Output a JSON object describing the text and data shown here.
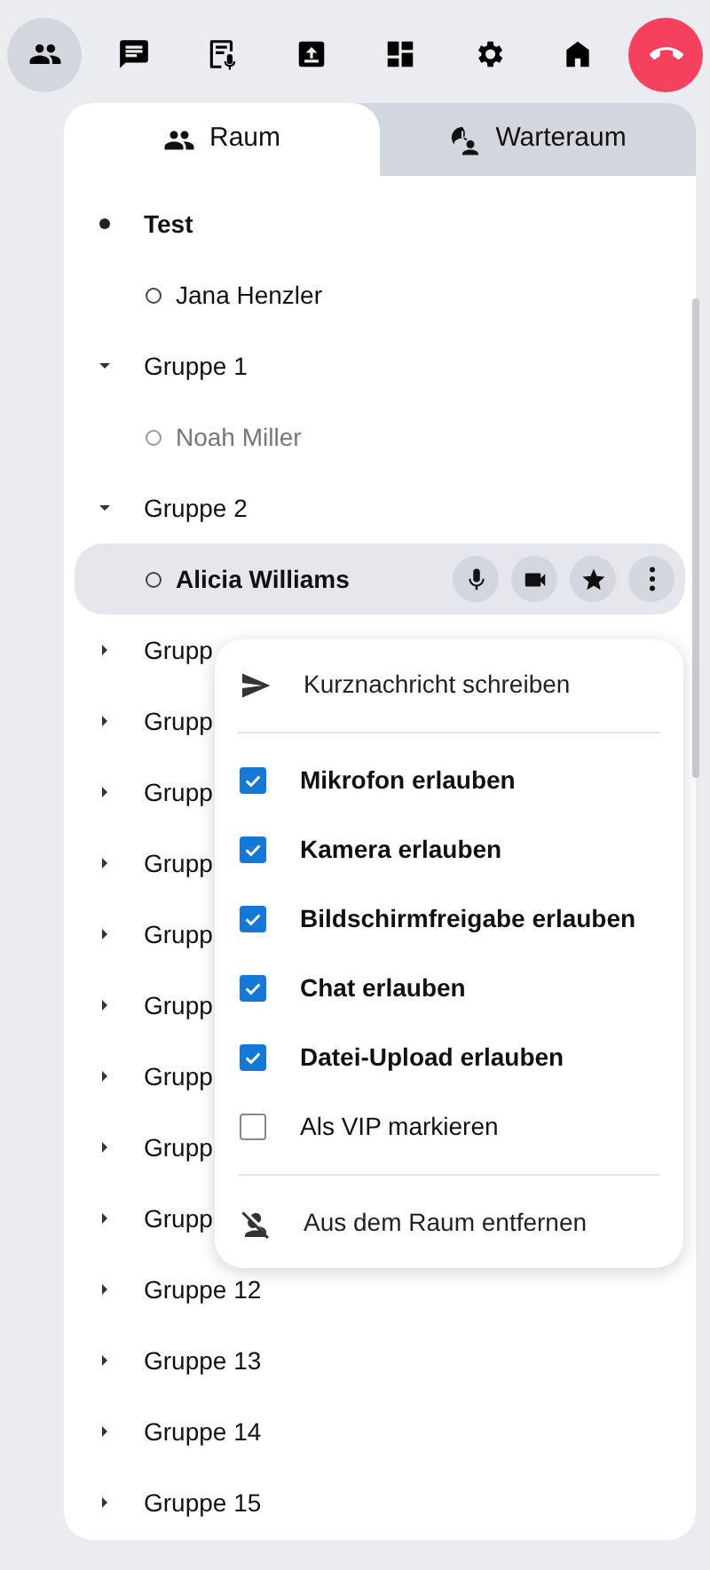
{
  "toolbar": [
    {
      "selected": true
    },
    {
      "selected": false
    },
    {
      "selected": false
    },
    {
      "selected": false
    },
    {
      "selected": false
    },
    {
      "selected": false
    },
    {
      "selected": false
    },
    {
      "selected": false
    }
  ],
  "tabs": [
    {
      "label": "Raum",
      "selected": true
    },
    {
      "label": "Warteraum",
      "selected": false
    }
  ],
  "tree": [
    {
      "kind": "room",
      "label": "Test",
      "children": [
        {
          "label": "Jana Henzler",
          "selected": false,
          "away": false
        }
      ]
    },
    {
      "kind": "group",
      "label": "Gruppe 1",
      "expanded": true,
      "children": [
        {
          "label": "Noah Miller",
          "selected": false,
          "away": true
        }
      ]
    },
    {
      "kind": "group",
      "label": "Gruppe 2",
      "expanded": true,
      "children": [
        {
          "label": "Alicia Williams",
          "selected": true,
          "away": false
        }
      ]
    },
    {
      "kind": "group",
      "label": "Grupp",
      "expanded": false
    },
    {
      "kind": "group",
      "label": "Grupp",
      "expanded": false
    },
    {
      "kind": "group",
      "label": "Grupp",
      "expanded": false
    },
    {
      "kind": "group",
      "label": "Grupp",
      "expanded": false
    },
    {
      "kind": "group",
      "label": "Grupp",
      "expanded": false
    },
    {
      "kind": "group",
      "label": "Grupp",
      "expanded": false
    },
    {
      "kind": "group",
      "label": "Grupp",
      "expanded": false
    },
    {
      "kind": "group",
      "label": "Grupp",
      "expanded": false
    },
    {
      "kind": "group",
      "label": "Grupp",
      "expanded": false
    },
    {
      "kind": "group",
      "label": "Gruppe 12",
      "expanded": false
    },
    {
      "kind": "group",
      "label": "Gruppe 13",
      "expanded": false
    },
    {
      "kind": "group",
      "label": "Gruppe 14",
      "expanded": false
    },
    {
      "kind": "group",
      "label": "Gruppe 15",
      "expanded": false
    }
  ],
  "context_menu": [
    {
      "kind": "action",
      "label": "Kurznachricht schreiben"
    },
    {
      "kind": "divider"
    },
    {
      "kind": "checkbox",
      "label": "Mikrofon erlauben",
      "checked": true
    },
    {
      "kind": "checkbox",
      "label": "Kamera erlauben",
      "checked": true
    },
    {
      "kind": "checkbox",
      "label": "Bildschirmfreigabe erlauben",
      "checked": true
    },
    {
      "kind": "checkbox",
      "label": "Chat erlauben",
      "checked": true
    },
    {
      "kind": "checkbox",
      "label": "Datei-Upload erlauben",
      "checked": true
    },
    {
      "kind": "checkbox",
      "label": "Als VIP markieren",
      "checked": false
    },
    {
      "kind": "divider"
    },
    {
      "kind": "action",
      "label": "Aus dem Raum entfernen"
    }
  ]
}
